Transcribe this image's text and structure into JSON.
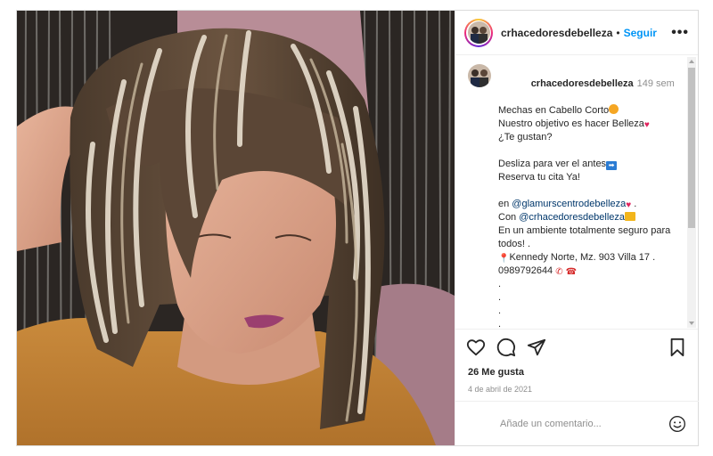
{
  "post": {
    "username": "crhacedoresdebelleza",
    "follow_label": "Seguir",
    "more_label": "•••",
    "separator": "•",
    "image_alt": "Mechas en cabello corto"
  },
  "caption": {
    "username": "crhacedoresdebelleza",
    "time": "149 sem",
    "line1": "Mechas en Cabello Corto",
    "line2": "Nuestro objetivo es hacer Belleza",
    "line3": "¿Te gustan?",
    "line4": "Desliza para ver el antes",
    "line5": "Reserva tu cita Ya!",
    "line6_prefix": "en ",
    "mention1": "@glamurscentrodebelleza",
    "line6_suffix": " .",
    "line7_prefix": "Con ",
    "mention2": "@crhacedoresdebelleza",
    "line8": "En un ambiente totalmente seguro para",
    "line9": "todos! .",
    "line10": "Kennedy Norte, Mz. 903 Villa 17 .",
    "line11": "0989792644",
    "dots": [
      ".",
      ".",
      ".",
      ".",
      ".",
      "."
    ]
  },
  "actions": {
    "likes": "26 Me gusta",
    "date": "4 de abril de 2021"
  },
  "comment": {
    "placeholder": "Añade un comentario..."
  },
  "icons": {
    "like": "heart-icon",
    "comment": "comment-icon",
    "share": "share-icon",
    "save": "bookmark-icon",
    "emoji": "emoji-icon",
    "more": "more-icon"
  },
  "colors": {
    "accent": "#0095f6",
    "mention": "#00376b",
    "muted": "#8e8e8e",
    "border": "#dbdbdb"
  }
}
